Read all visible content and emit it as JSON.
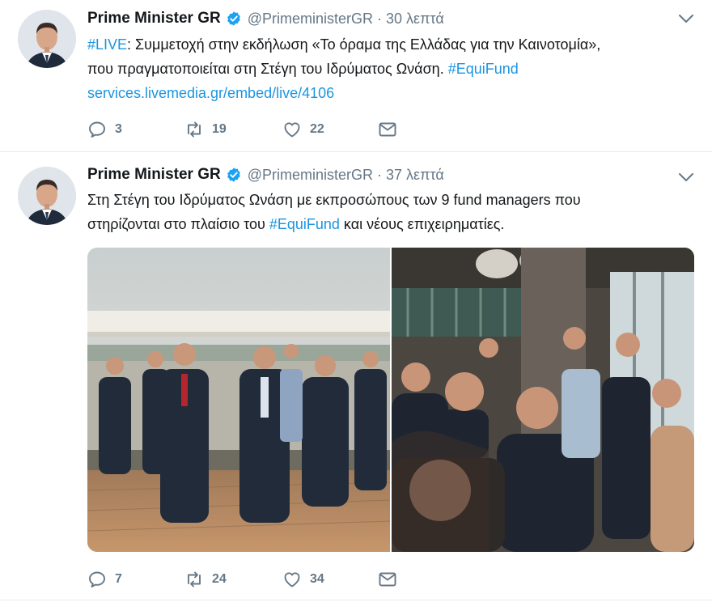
{
  "tweets": [
    {
      "name": "Prime Minister GR",
      "handle": "@PrimeministerGR",
      "separator": "·",
      "time": "30 λεπτά",
      "line1_tag": "#LIVE",
      "line1_rest": ": Συμμετοχή στην εκδήλωση «Το όραμα της Ελλάδας για την Καινοτομία»,",
      "line2_text": "που πραγματοποιείται στη Στέγη του Ιδρύματος Ωνάση. ",
      "line2_tag": "#EquiFund",
      "link": "services.livemedia.gr/embed/live/4106",
      "replies": "3",
      "retweets": "19",
      "likes": "22"
    },
    {
      "name": "Prime Minister GR",
      "handle": "@PrimeministerGR",
      "separator": "·",
      "time": "37 λεπτά",
      "line1": "Στη Στέγη του Ιδρύματος Ωνάση με εκπροσώπους των 9 fund managers που",
      "line2_pre": "στηρίζονται στο πλαίσιο του ",
      "line2_tag": "#EquiFund",
      "line2_post": " και νέους επιχειρηματίες.",
      "replies": "7",
      "retweets": "24",
      "likes": "34"
    }
  ],
  "icons": {
    "reply": "reply-icon",
    "retweet": "retweet-icon",
    "like": "heart-icon",
    "dm": "envelope-icon",
    "verified": "verified-badge-icon",
    "more": "chevron-down-icon"
  },
  "colors": {
    "link": "#1b95e0",
    "secondary": "#657786",
    "verified": "#1da1f2",
    "border": "#e6ecf0"
  }
}
